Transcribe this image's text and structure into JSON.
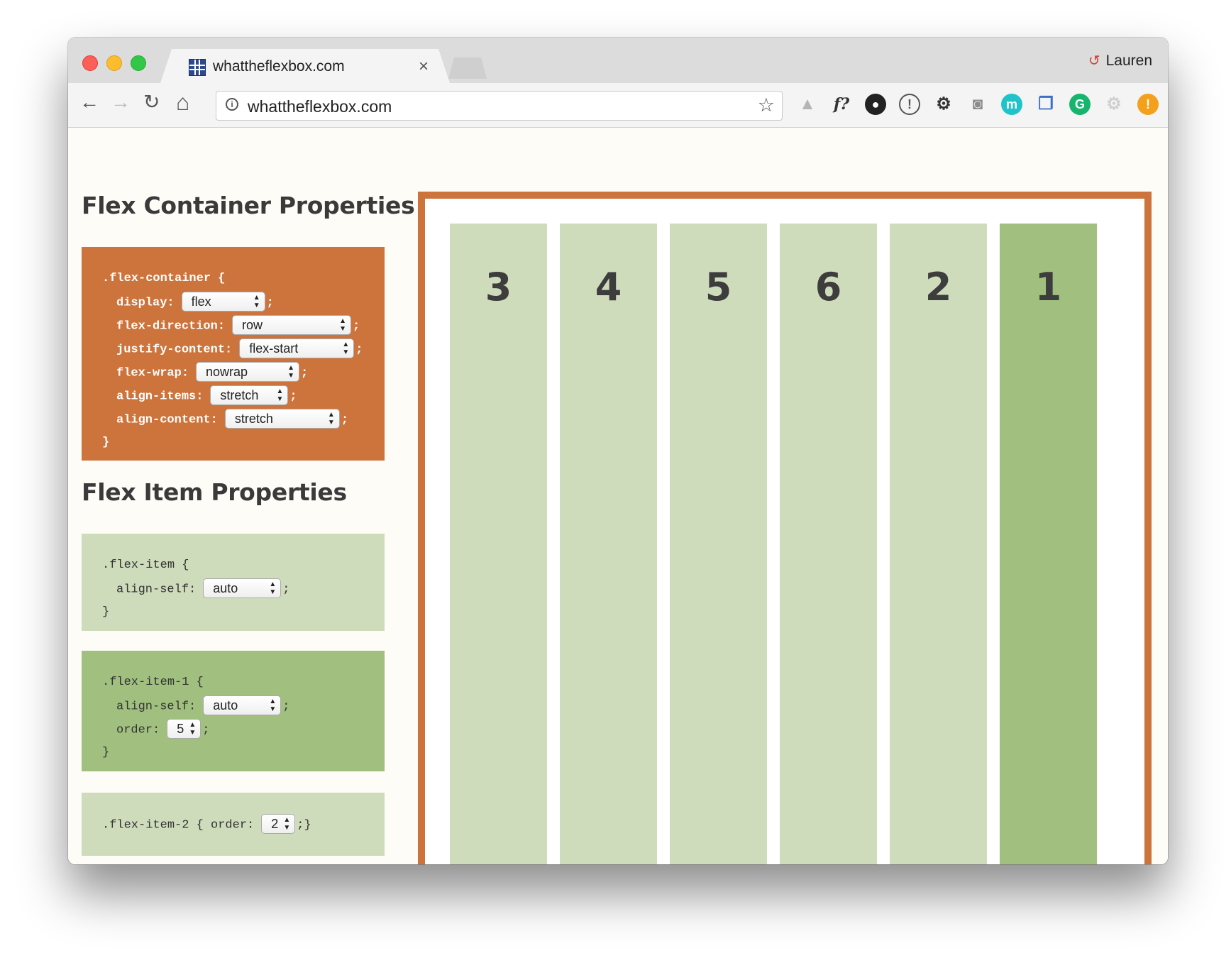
{
  "browser": {
    "tab_title": "whattheflexbox.com",
    "tab_close": "×",
    "profile_name": "Lauren",
    "url": "whattheflexbox.com",
    "nav": {
      "back": "←",
      "forward": "→",
      "reload": "↻",
      "home": "⌂"
    },
    "extensions": [
      {
        "name": "google-drive-icon",
        "glyph": "▲",
        "color": "#b5b5b5"
      },
      {
        "name": "whatfont-icon",
        "glyph": "f?",
        "color": "#333333"
      },
      {
        "name": "color-picker-icon",
        "glyph": "●",
        "color": "#222222"
      },
      {
        "name": "onepassword-icon",
        "glyph": "!",
        "color": "#555555"
      },
      {
        "name": "gear-icon",
        "glyph": "⚙",
        "color": "#333333"
      },
      {
        "name": "camera-icon",
        "glyph": "◙",
        "color": "#8c8c8c"
      },
      {
        "name": "m-icon",
        "glyph": "m",
        "color": "#1fc3c9"
      },
      {
        "name": "windows-icon",
        "glyph": "❐",
        "color": "#3d6fc7"
      },
      {
        "name": "grammarly-icon",
        "glyph": "G",
        "color": "#16b46c"
      },
      {
        "name": "settings-disabled-icon",
        "glyph": "⚙",
        "color": "#cfcfcf"
      },
      {
        "name": "alert-icon",
        "glyph": "!",
        "color": "#f3a11c"
      }
    ]
  },
  "container_section": {
    "heading": "Flex Container Properties",
    "selector": ".flex-container {",
    "close": "}",
    "props": [
      {
        "label": "display:",
        "value": "flex"
      },
      {
        "label": "flex-direction:",
        "value": "row"
      },
      {
        "label": "justify-content:",
        "value": "flex-start"
      },
      {
        "label": "flex-wrap:",
        "value": "nowrap"
      },
      {
        "label": "align-items:",
        "value": "stretch"
      },
      {
        "label": "align-content:",
        "value": "stretch"
      }
    ]
  },
  "item_section": {
    "heading": "Flex Item Properties",
    "item": {
      "selector": ".flex-item {",
      "label": "align-self:",
      "value": "auto",
      "close": "}"
    },
    "item1": {
      "selector": ".flex-item-1 {",
      "align_label": "align-self:",
      "align_value": "auto",
      "order_label": "order:",
      "order_value": "5",
      "close": "}"
    },
    "item2": {
      "selector": ".flex-item-2 { order:",
      "order_value": "2",
      "close": ";}"
    }
  },
  "flex_items": [
    "3",
    "4",
    "5",
    "6",
    "2",
    "1"
  ],
  "colors": {
    "accent": "#cc743c",
    "item": "#cfdcbc",
    "item_active": "#a1c07f"
  }
}
